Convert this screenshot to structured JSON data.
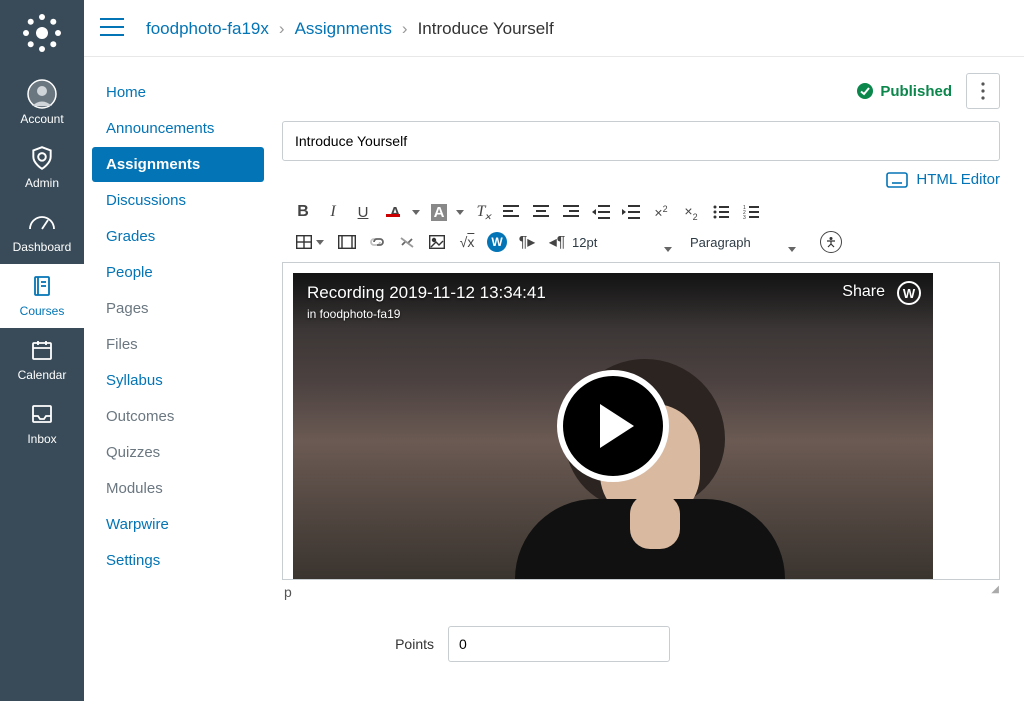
{
  "globalNav": {
    "items": [
      {
        "key": "account",
        "label": "Account"
      },
      {
        "key": "admin",
        "label": "Admin"
      },
      {
        "key": "dashboard",
        "label": "Dashboard"
      },
      {
        "key": "courses",
        "label": "Courses"
      },
      {
        "key": "calendar",
        "label": "Calendar"
      },
      {
        "key": "inbox",
        "label": "Inbox"
      }
    ],
    "active": "courses"
  },
  "breadcrumb": {
    "course": "foodphoto-fa19x",
    "section": "Assignments",
    "page": "Introduce Yourself"
  },
  "courseNav": {
    "items": [
      {
        "label": "Home",
        "state": "enabled"
      },
      {
        "label": "Announcements",
        "state": "enabled"
      },
      {
        "label": "Assignments",
        "state": "active"
      },
      {
        "label": "Discussions",
        "state": "enabled"
      },
      {
        "label": "Grades",
        "state": "enabled"
      },
      {
        "label": "People",
        "state": "enabled"
      },
      {
        "label": "Pages",
        "state": "disabled"
      },
      {
        "label": "Files",
        "state": "disabled"
      },
      {
        "label": "Syllabus",
        "state": "enabled"
      },
      {
        "label": "Outcomes",
        "state": "disabled"
      },
      {
        "label": "Quizzes",
        "state": "disabled"
      },
      {
        "label": "Modules",
        "state": "disabled"
      },
      {
        "label": "Warpwire",
        "state": "enabled"
      },
      {
        "label": "Settings",
        "state": "enabled"
      }
    ]
  },
  "header": {
    "published": "Published"
  },
  "assignment": {
    "title": "Introduce Yourself"
  },
  "editor": {
    "htmlEditorLabel": "HTML Editor",
    "fontSize": "12pt",
    "paragraph": "Paragraph",
    "statusPath": "p"
  },
  "video": {
    "title": "Recording 2019-11-12 13:34:41",
    "subtitle": "in foodphoto-fa19",
    "share": "Share"
  },
  "points": {
    "label": "Points",
    "value": "0"
  }
}
